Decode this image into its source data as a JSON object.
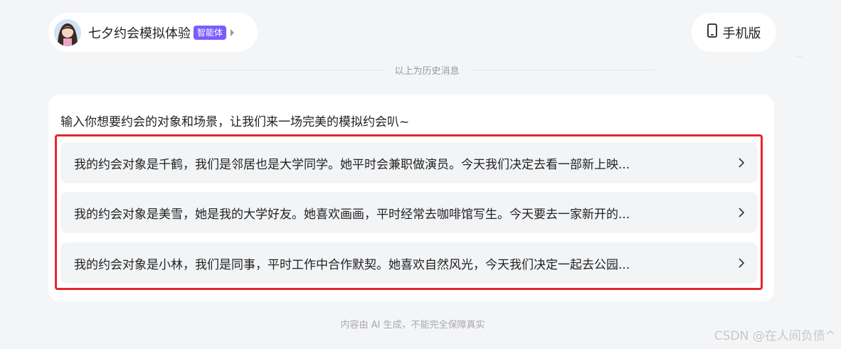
{
  "header": {
    "bot_name": "七夕约会模拟体验",
    "badge": "智能体",
    "mobile_label": "手机版",
    "avatar_icon": "avatar-girl",
    "mobile_icon": "phone-icon"
  },
  "history_divider": "以上为历史消息",
  "card": {
    "prompt": "输入你想要约会的对象和场景，让我们来一场完美的模拟约会叭~",
    "suggestions": [
      {
        "text": "我的约会对象是千鹤，我们是邻居也是大学同学。她平时会兼职做演员。今天我们决定去看一部新上映..."
      },
      {
        "text": "我的约会对象是美雪，她是我的大学好友。她喜欢画画，平时经常去咖啡馆写生。今天要去一家新开的..."
      },
      {
        "text": "我的约会对象是小林，我们是同事，平时工作中合作默契。她喜欢自然风光，今天我们决定一起去公园..."
      }
    ]
  },
  "footer": "内容由 AI 生成，不能完全保障真实",
  "watermark": "CSDN @在人间负债^",
  "colors": {
    "badge": "#7b5cff",
    "highlight_border": "#e5272b",
    "suggestion_bg": "#f3f4f6",
    "page_bg": "#f4f5f7"
  }
}
